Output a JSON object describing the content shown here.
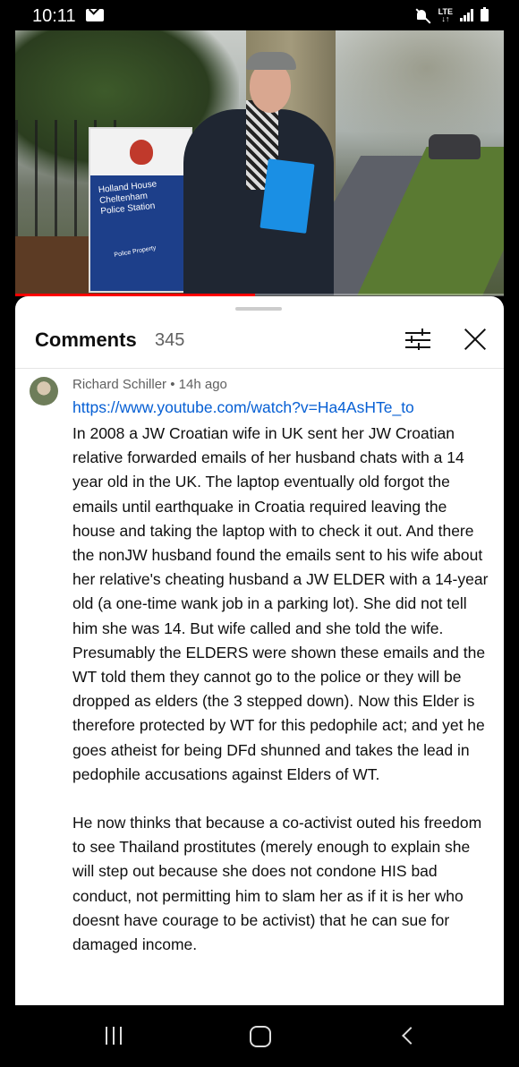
{
  "status_bar": {
    "time": "10:11",
    "network": "LTE",
    "icons": [
      "mail-icon",
      "mute-icon",
      "signal-icon",
      "battery-icon"
    ]
  },
  "video": {
    "sign_lines": [
      "Holland House",
      "Cheltenham",
      "Police Station"
    ],
    "sign_small": "Police Property",
    "progress": 0.49,
    "progress_color": "#ff0000"
  },
  "comments": {
    "title": "Comments",
    "count": "345",
    "items": [
      {
        "author": "Richard Schiller",
        "separator": "•",
        "time": "14h ago",
        "link": "https://www.youtube.com/watch?v=Ha4AsHTe_to",
        "paragraphs": [
          "In 2008 a JW Croatian wife in UK sent her JW Croatian relative forwarded emails of her husband chats with a 14 year old in the UK.  The laptop eventually old forgot the emails until earthquake in Croatia required leaving the house and taking the laptop with to check it out. And there the nonJW husband found the emails sent to his wife about her relative's cheating husband a JW ELDER with a 14-year old (a one-time wank job in a parking lot). She did not tell him she was 14. But wife called and she told the wife. Presumably the ELDERS were shown these emails and the WT told them they cannot go to the police or they will be dropped as elders (the 3 stepped down). Now this Elder is therefore protected by WT for this pedophile act; and yet he goes atheist for being DFd shunned and takes the lead in pedophile accusations against Elders of WT.",
          "He now thinks that because a co-activist outed his freedom to see Thailand prostitutes (merely enough to explain she will step out because she does not condone HIS bad conduct, not permitting him to slam her as if it is her who doesnt have courage to be activist) that he can sue for damaged income."
        ]
      }
    ]
  },
  "colors": {
    "link": "#065fd4",
    "text": "#0f0f0f",
    "meta": "#606060"
  }
}
